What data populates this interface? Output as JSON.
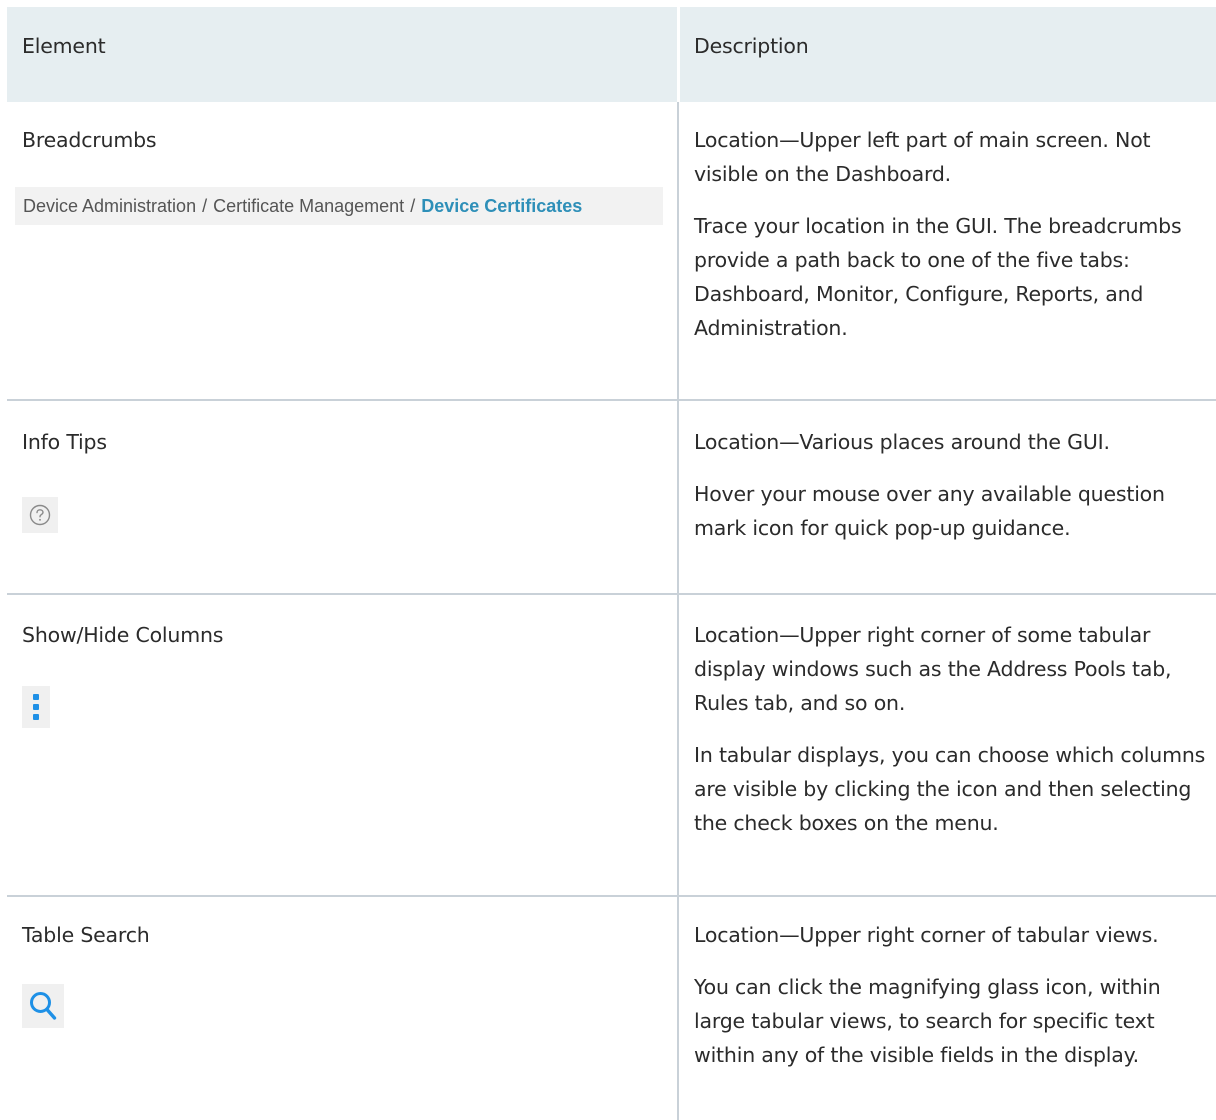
{
  "table": {
    "headers": {
      "element": "Element",
      "description": "Description"
    },
    "rows": [
      {
        "element": "Breadcrumbs",
        "breadcrumb": [
          "Device Administration",
          "Certificate Management",
          "Device Certificates"
        ],
        "separator": "/",
        "desc": [
          "Location—Upper left part of main screen. Not visible on the Dashboard.",
          "Trace your location in the GUI. The breadcrumbs provide a path back to one of the five tabs: Dashboard, Monitor, Configure, Reports, and Administration."
        ]
      },
      {
        "element": "Info Tips",
        "icon": "question-circle-icon",
        "desc": [
          "Location—Various places around the GUI.",
          "Hover your mouse over any available question mark icon for quick pop-up guidance."
        ]
      },
      {
        "element": "Show/Hide Columns",
        "icon": "vertical-ellipsis-icon",
        "desc": [
          "Location—Upper right corner of some tabular display windows such as the Address Pools tab, Rules tab, and so on.",
          "In tabular displays, you can choose which columns are visible by clicking the icon and then selecting the check boxes on the menu."
        ]
      },
      {
        "element": "Table Search",
        "icon": "magnifying-glass-icon",
        "desc": [
          "Location—Upper right corner of tabular views.",
          "You can click the magnifying glass icon, within large tabular views, to search for specific text within any of the visible fields in the display."
        ]
      }
    ]
  },
  "colors": {
    "header_bg": "#e6eef1",
    "rule": "#c9d1d8",
    "crumb_current": "#2e8fb8",
    "icon_blue": "#1e90e6"
  }
}
